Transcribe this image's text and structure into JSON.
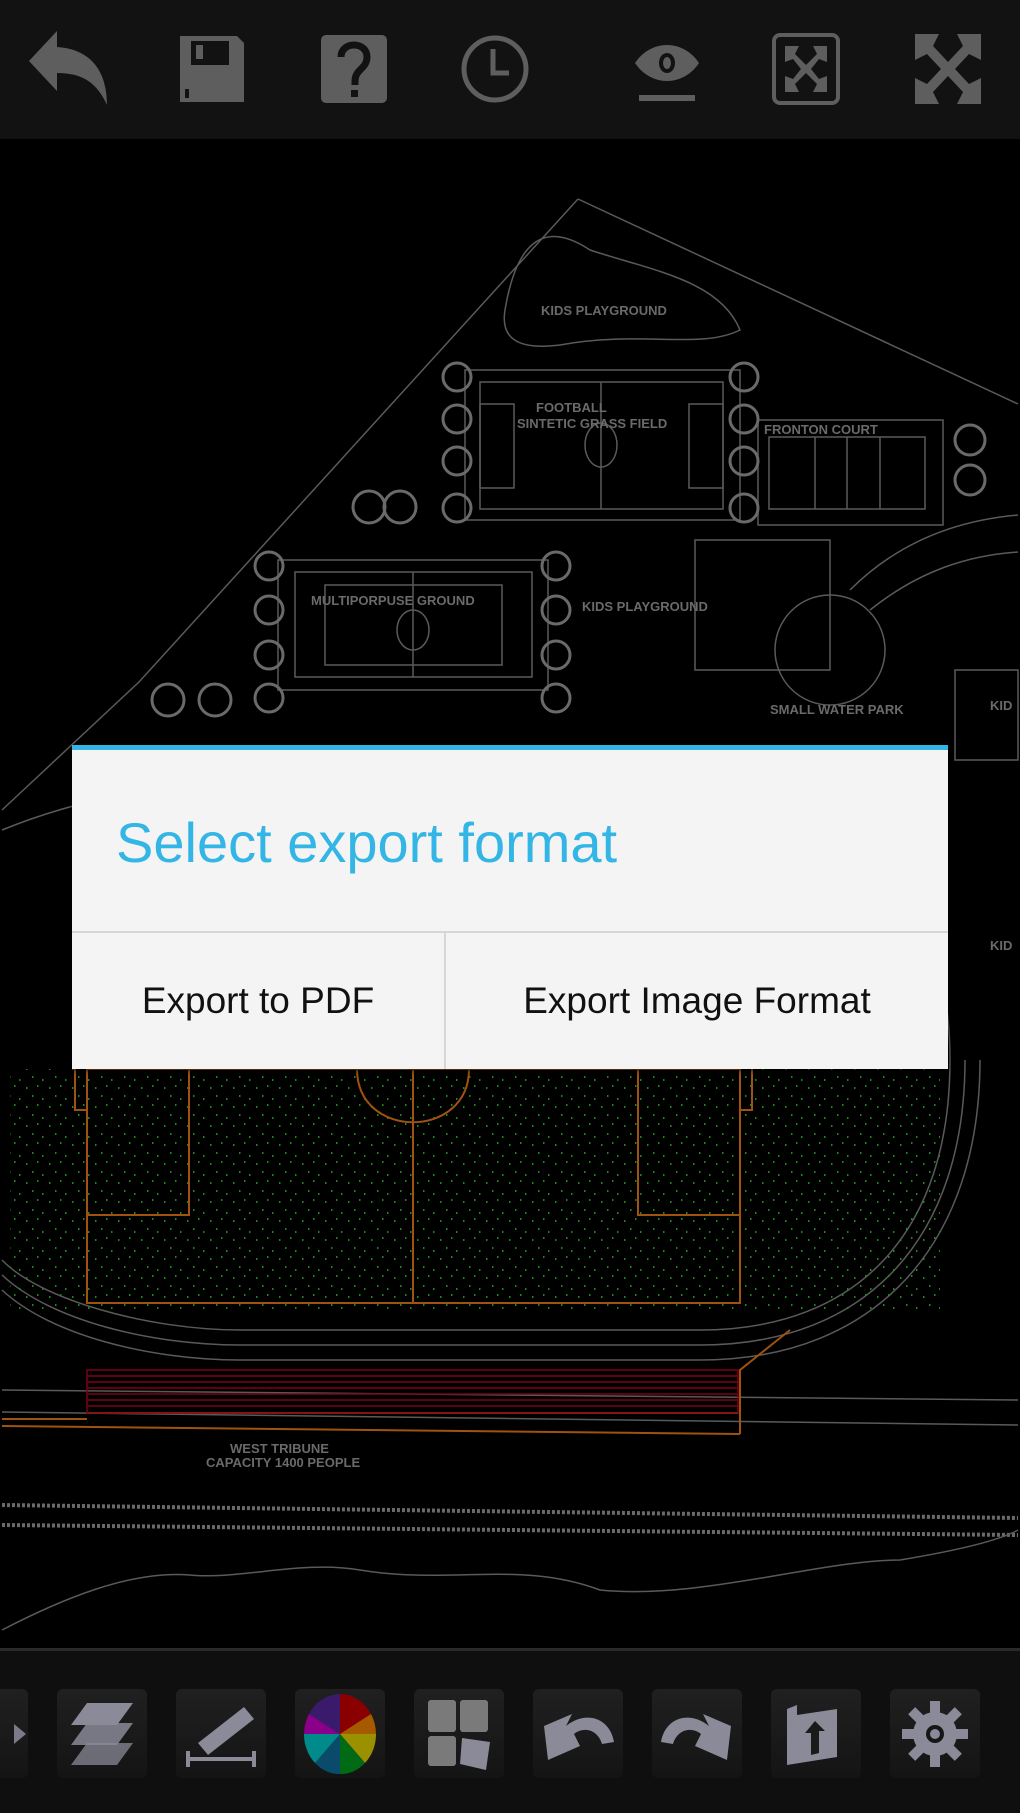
{
  "toolbar_top": {
    "icons": [
      "back-arrow-icon",
      "save-floppy-icon",
      "help-question-icon",
      "clock-history-icon",
      "eye-view-icon",
      "fit-to-screen-icon",
      "fullscreen-expand-icon"
    ]
  },
  "drawing": {
    "labels": {
      "kids_playground_top": "KIDS PLAYGROUND",
      "football": "FOOTBALL",
      "sintetic": "SINTETIC GRASS FIELD",
      "fronton": "FRONTON COURT",
      "multipurpose": "MULTIPORPUSE GROUND",
      "kids_playground_mid": "KIDS PLAYGROUND",
      "water_park": "SMALL WATER PARK",
      "kid_partial_1": "KID",
      "kid_partial_2": "KID",
      "west_tribune": "WEST TRIBUNE",
      "capacity": "CAPACITY 1400 PEOPLE"
    },
    "colors": {
      "lines": "#5a5a5a",
      "field": "#a0520f",
      "grass": "#1a8a1a",
      "tribune": "#7a0018"
    }
  },
  "dialog": {
    "title": "Select export format",
    "buttons": [
      "Export to PDF",
      "Export Image Format"
    ],
    "accent": "#33b5e5"
  },
  "toolbar_bottom": {
    "icons": [
      "partial-tool-icon",
      "layers-icon",
      "measure-ruler-icon",
      "color-wheel-icon",
      "layout-grid-icon",
      "undo-icon",
      "redo-icon",
      "open-folder-icon",
      "settings-gear-icon"
    ]
  }
}
